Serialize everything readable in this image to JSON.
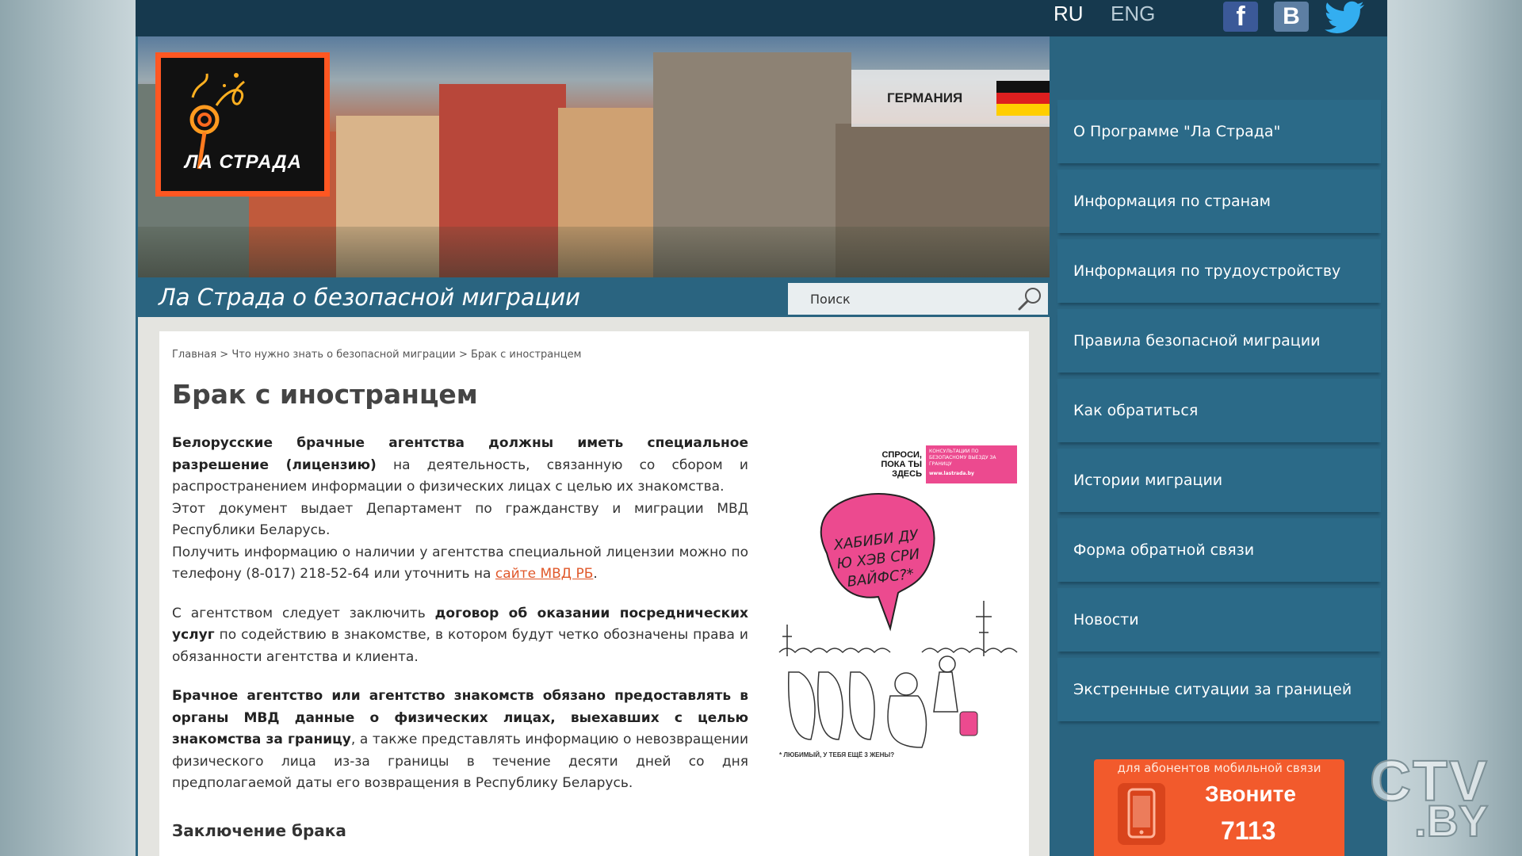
{
  "header": {
    "lang_ru": "RU",
    "lang_eng": "ENG",
    "social": {
      "facebook": "f",
      "vkontakte": "B"
    }
  },
  "logo": {
    "text": "ЛА СТРАДА"
  },
  "banner": {
    "country": "ГЕРМАНИЯ"
  },
  "tagline": "Ла Страда о безопасной миграции",
  "search": {
    "placeholder": "Поиск"
  },
  "breadcrumbs": [
    "Главная",
    ">",
    "Что нужно знать о безопасной миграции",
    ">",
    "Брак с иностранцем"
  ],
  "article": {
    "title": "Брак с иностранцем",
    "p1_bold": "Белорусские брачные агентства должны иметь специальное разрешение (лицензию)",
    "p1_rest": " на деятельность, связанную со сбором и распространением информации о физических лицах с целью их знакомства.",
    "p1_line2": "Этот документ выдает Департамент по гражданству и миграции МВД Республики Беларусь.",
    "p1_line3": "Получить информацию о наличии у агентства специальной лицензии можно по телефону (8-017) 218-52-64 или уточнить на ",
    "p1_link": "сайте МВД РБ",
    "p1_end": ".",
    "p2_start": "С агентством следует заключить ",
    "p2_bold": "договор об оказании посреднических услуг",
    "p2_rest": " по содействию в знакомстве, в котором будут четко обозначены права и обязанности агентства и клиента.",
    "p3_bold": "Брачное агентство или агентство знакомств обязано предоставлять в органы МВД данные о физических лицах, выехавших с целью знакомства за границу",
    "p3_rest": ", а также представлять информацию о невозвращении физического лица из-за границы в течение десяти дней со дня предполагаемой даты его возвращения в Республику Беларусь.",
    "subheading": "Заключение брака"
  },
  "poster": {
    "ask": "СПРОСИ, ПОКА ТЫ ЗДЕСЬ",
    "pink_text": "КОНСУЛЬТАЦИИ ПО БЕЗОПАСНОМУ ВЫЕЗДУ ЗА ГРАНИЦУ",
    "pink_url": "www.lastrada.by",
    "bubble": "ХАБИБИ ДУ Ю ХЭВ СРИ ВАЙФС?*",
    "caption": "* ЛЮБИМЫЙ, У ТЕБЯ ЕЩЁ 3 ЖЕНЫ?"
  },
  "nav": {
    "items": [
      "О Программе \"Ла Страда\"",
      "Информация по странам",
      "Информация по трудоустройству",
      "Правила безопасной миграции",
      "Как обратиться",
      "Истории миграции",
      "Форма обратной связи",
      "Новости",
      "Экстренные ситуации за границей"
    ]
  },
  "call": {
    "subtitle": "для абонентов мобильной связи",
    "title": "Звоните",
    "number": "7113"
  },
  "watermark": {
    "ctv": "CTV",
    "by": ".BY"
  },
  "colors": {
    "site_bg": "#2a6480",
    "topbar": "#16394e",
    "accent_orange": "#f25a2c",
    "link": "#e0582a",
    "poster_pink": "#ec4a8f"
  }
}
